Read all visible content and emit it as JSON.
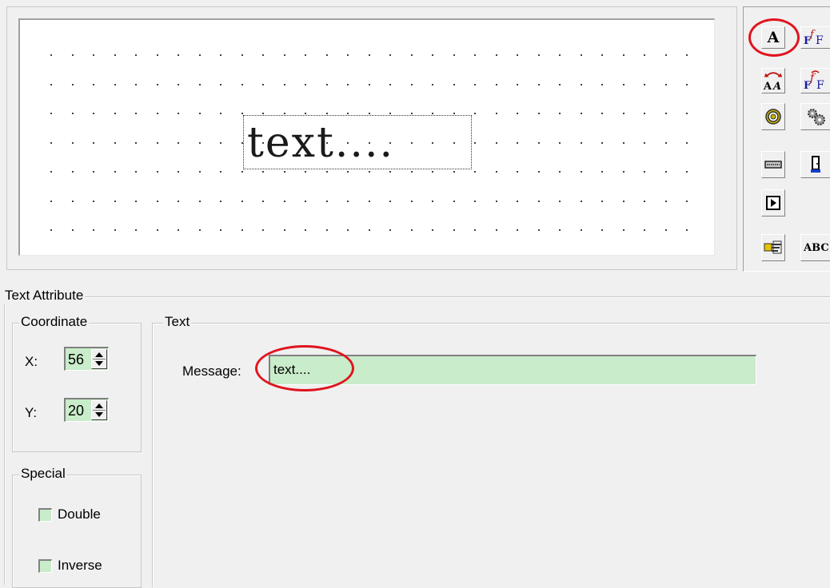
{
  "canvas": {
    "text_object": "text...."
  },
  "toolbar": {
    "tools": [
      {
        "name": "text-tool-icon",
        "label": "A",
        "selected": true
      },
      {
        "name": "font-tool-icon"
      },
      {
        "name": "text-resize-icon",
        "label": "AA"
      },
      {
        "name": "font-edit-icon"
      },
      {
        "name": "target-icon"
      },
      {
        "name": "gears-icon"
      },
      {
        "name": "keyboard-icon"
      },
      {
        "name": "door-icon"
      },
      {
        "name": "play-icon"
      },
      {
        "name": "hand-pointer-icon"
      },
      {
        "name": "abc-tool-icon",
        "label": "ABC"
      }
    ]
  },
  "attributes": {
    "title": "Text Attribute",
    "coordinate": {
      "title": "Coordinate",
      "x_label": "X:",
      "x_value": "56",
      "y_label": "Y:",
      "y_value": "20"
    },
    "special": {
      "title": "Special",
      "double_label": "Double",
      "inverse_label": "Inverse"
    },
    "text": {
      "title": "Text",
      "message_label": "Message:",
      "message_value": "text...."
    }
  },
  "colors": {
    "field_background": "#c9ecca",
    "highlight_ring": "#e0141e",
    "window_background": "#f0f0f0"
  }
}
